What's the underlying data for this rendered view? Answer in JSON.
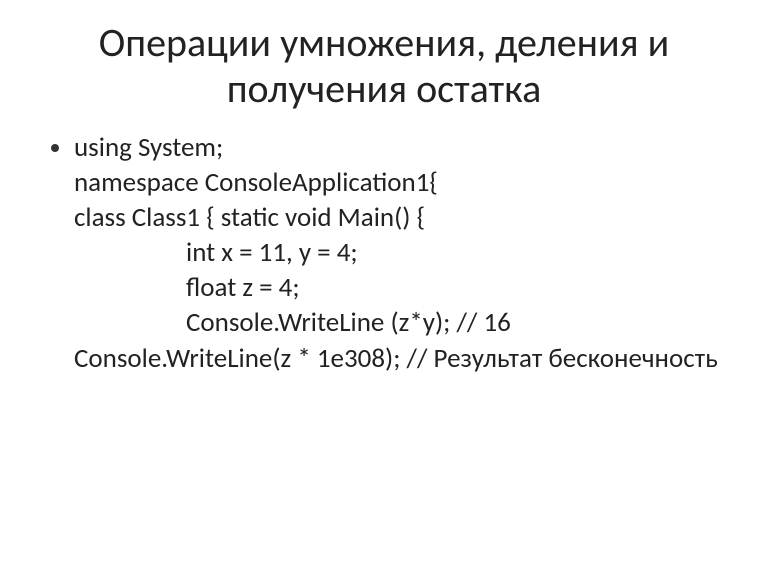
{
  "title": "Операции умножения, деления и получения остатка",
  "code": {
    "l1": "using System;",
    "l2": "namespace ConsoleApplication1{",
    "l3": "class Class1   {   static void Main()  {",
    "l4": "int x = 11, y = 4;",
    "l5": "float z = 4;",
    "l6": "Console.WriteLine (z*y); // 16",
    "l7": "Console.WriteLine(z * 1e308); // Результат бесконечность"
  }
}
